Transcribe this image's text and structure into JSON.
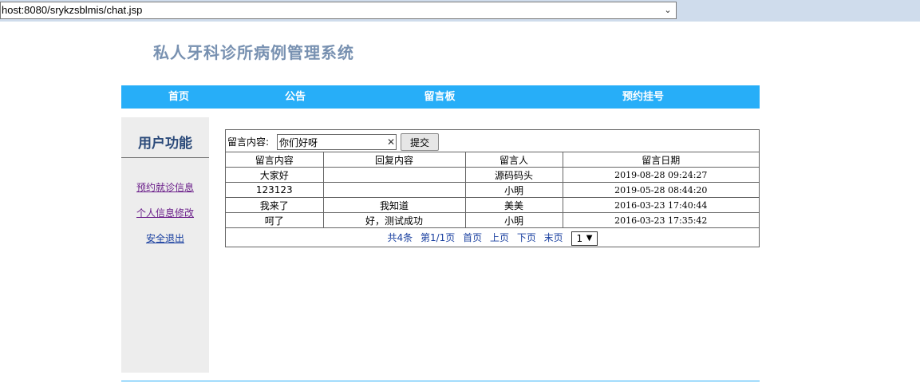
{
  "browser": {
    "url": "host:8080/srykzsblmis/chat.jsp"
  },
  "site": {
    "title": "私人牙科诊所病例管理系统"
  },
  "nav": {
    "items": [
      "首页",
      "公告",
      "留言板",
      "预约挂号"
    ]
  },
  "sidebar": {
    "title": "用户功能",
    "links": [
      "预约就诊信息",
      "个人信息修改",
      "安全退出"
    ]
  },
  "form": {
    "label": "留言内容:",
    "value": "你们好呀",
    "submit_label": "提交"
  },
  "table": {
    "headers": [
      "留言内容",
      "回复内容",
      "留言人",
      "留言日期"
    ],
    "rows": [
      [
        "大家好",
        "",
        "源码码头",
        "2019-08-28 09:24:27"
      ],
      [
        "123123",
        "",
        "小明",
        "2019-05-28 08:44:20"
      ],
      [
        "我来了",
        "我知道",
        "美美",
        "2016-03-23 17:40:44"
      ],
      [
        "呵了",
        "好，测试成功",
        "小明",
        "2016-03-23 17:35:42"
      ]
    ]
  },
  "pager": {
    "total": "共4条",
    "page": "第1/1页",
    "first": "首页",
    "prev": "上页",
    "next": "下页",
    "last": "末页",
    "selected": "1"
  },
  "colors": {
    "nav_bg": "#27aef8",
    "title": "#7891b1",
    "sidebar_bg": "#ededed"
  }
}
